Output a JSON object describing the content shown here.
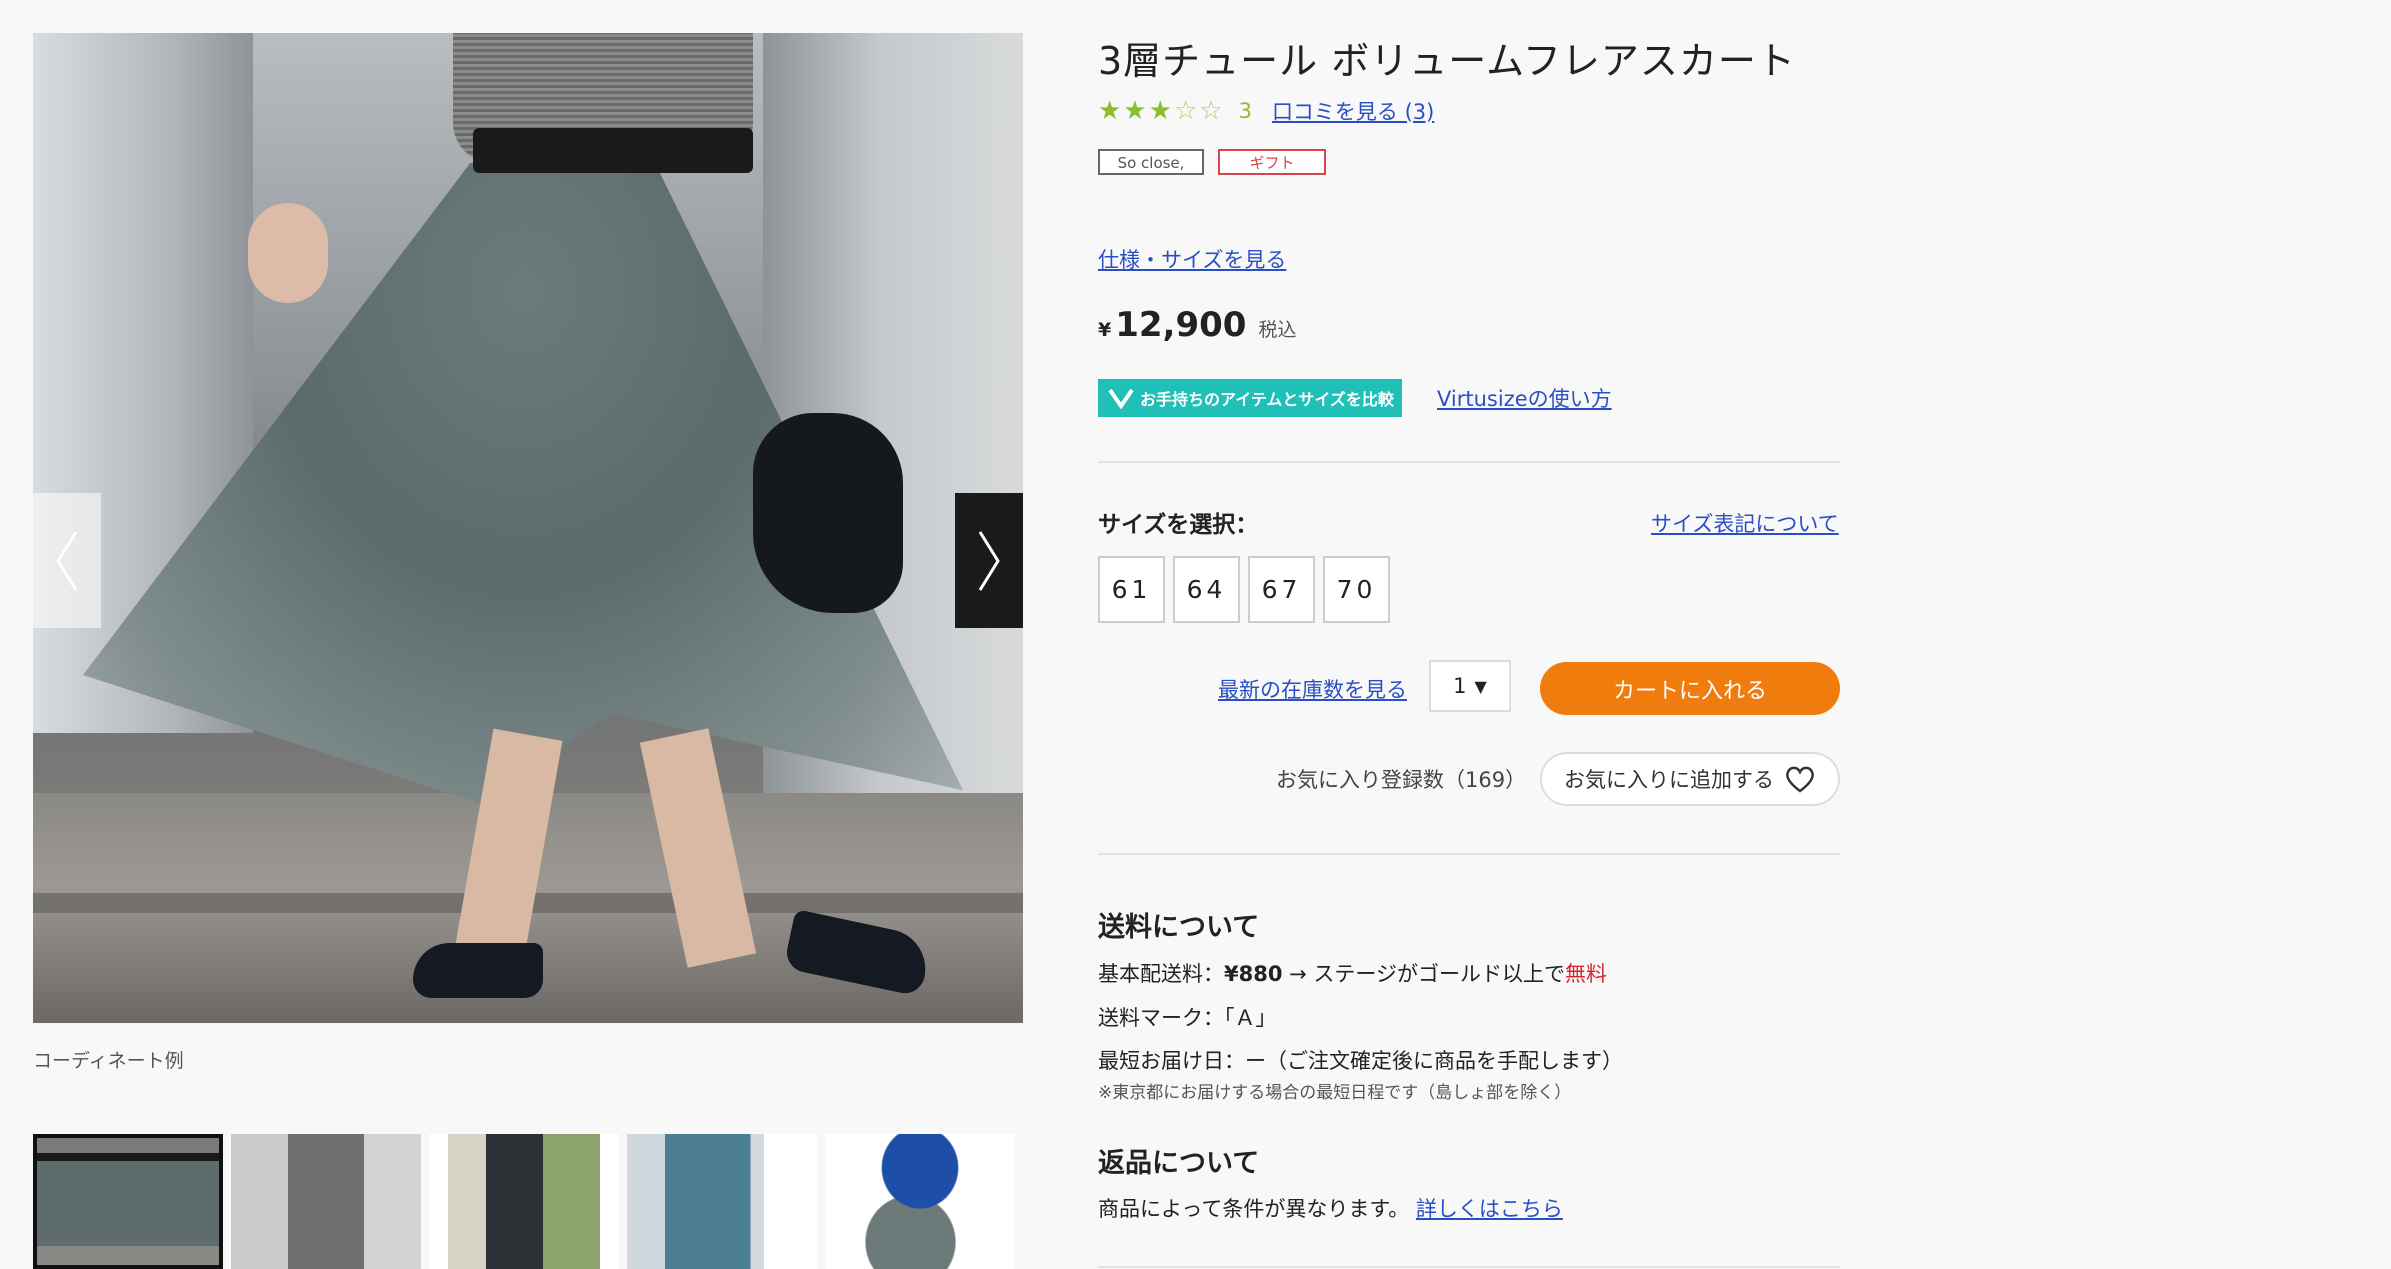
{
  "gallery": {
    "caption": "コーディネート例",
    "prev_arrow": "〈",
    "next_arrow": "〉",
    "thumbnails": [
      "thumb-1",
      "thumb-2",
      "thumb-3",
      "thumb-4",
      "thumb-5"
    ]
  },
  "product": {
    "title": "3層チュール ボリュームフレアスカート",
    "rating": {
      "stars_on": "★★★",
      "stars_off": "☆☆",
      "value": "3",
      "reviews_link": "口コミを見る (3)"
    },
    "tags": {
      "brand": "So close,",
      "gift": "ギフト"
    },
    "spec_link": "仕様・サイズを見る",
    "price": {
      "currency": "¥",
      "amount": "12,900",
      "tax": "税込"
    },
    "virtusize": {
      "button": "お手持ちのアイテムとサイズを比較",
      "link": "Virtusizeの使い方"
    }
  },
  "size": {
    "label": "サイズを選択：",
    "note_link": "サイズ表記について",
    "options": [
      "61",
      "64",
      "67",
      "70"
    ]
  },
  "purchase": {
    "stock_link": "最新の在庫数を見る",
    "quantity": "1",
    "qty_arrow": "▼",
    "cart_button": "カートに入れる",
    "favorite_count": "お気に入り登録数（169）",
    "favorite_button": "お気に入りに追加する"
  },
  "shipping": {
    "title": "送料について",
    "base_prefix": "基本配送料：",
    "base_fee": "¥880",
    "base_suffix": " → ステージがゴールド以上で",
    "free": "無料",
    "mark": "送料マーク：「Ａ」",
    "earliest": "最短お届け日：ー（ご注文確定後に商品を手配します）",
    "note": "※東京都にお届けする場合の最短日程です（島しょ部を除く）"
  },
  "returns": {
    "title": "返品について",
    "text": "商品によって条件が異なります。",
    "link": "詳しくはこちら"
  },
  "colors": {
    "accent_orange": "#f07c0d",
    "star_green": "#8bbf2f",
    "virtusize_teal": "#20c0b8",
    "gift_red": "#d9434b",
    "link_blue": "#2a4fc4"
  }
}
